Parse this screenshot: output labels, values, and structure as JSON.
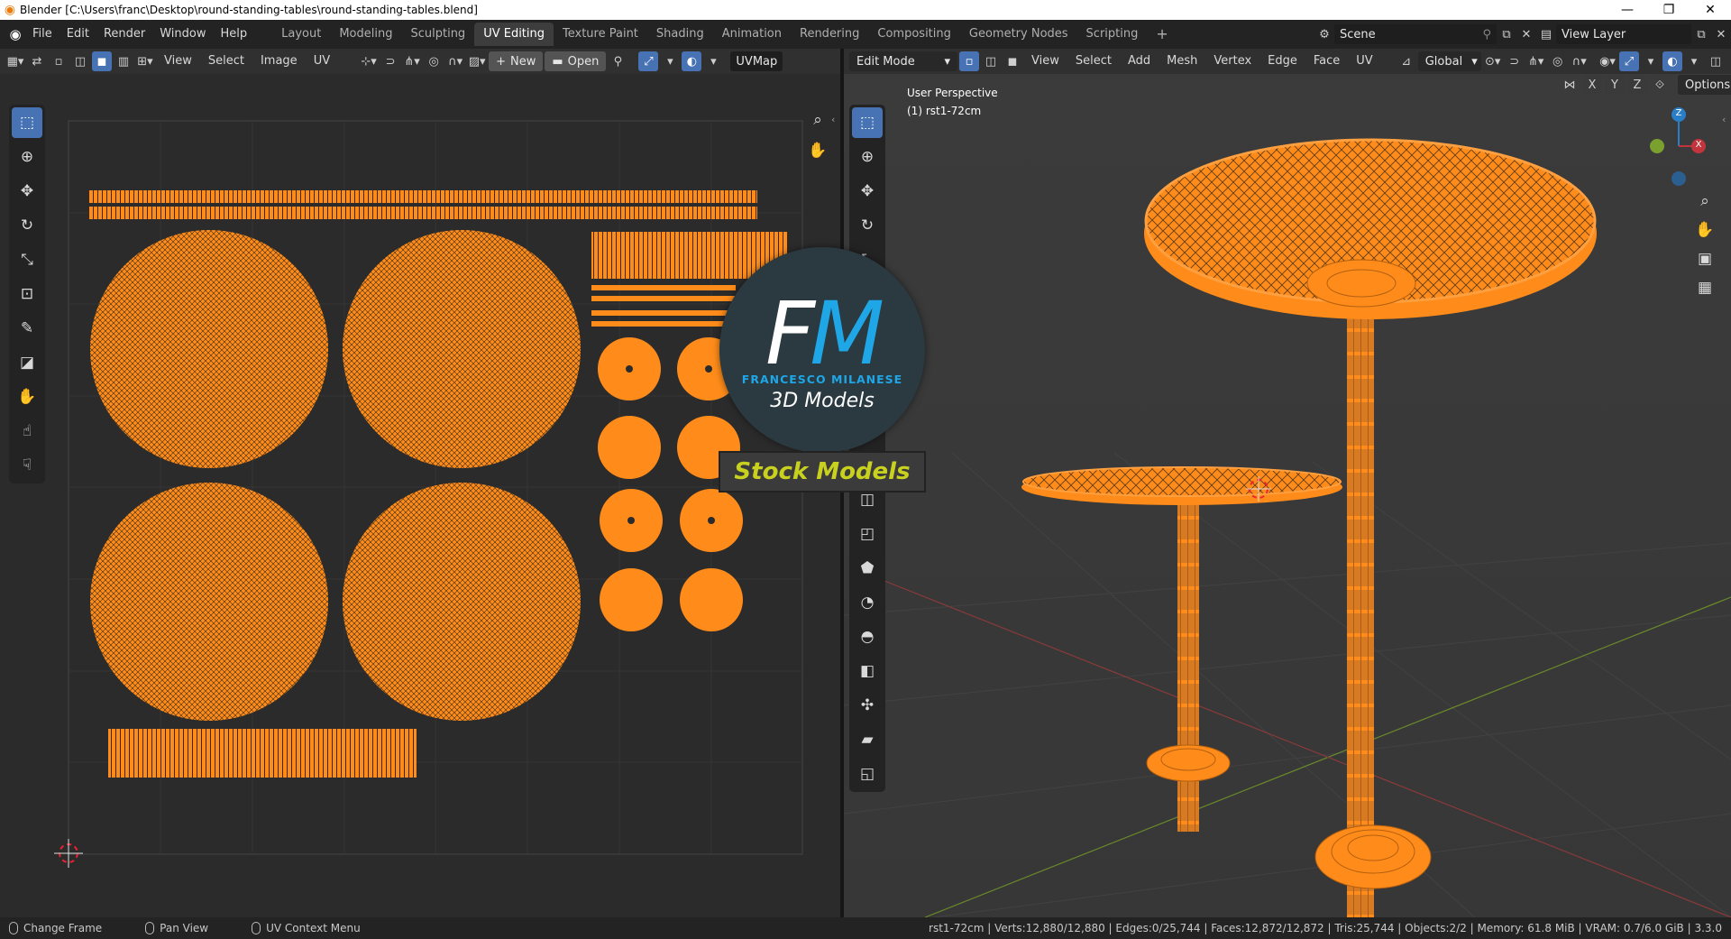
{
  "window": {
    "title": "Blender [C:\\Users\\franc\\Desktop\\round-standing-tables\\round-standing-tables.blend]",
    "minimize": "—",
    "maximize": "❐",
    "close": "✕"
  },
  "menu": {
    "file": "File",
    "edit": "Edit",
    "render": "Render",
    "window": "Window",
    "help": "Help"
  },
  "workspaces": [
    "Layout",
    "Modeling",
    "Sculpting",
    "UV Editing",
    "Texture Paint",
    "Shading",
    "Animation",
    "Rendering",
    "Compositing",
    "Geometry Nodes",
    "Scripting"
  ],
  "active_workspace": "UV Editing",
  "add_workspace": "+",
  "scene": {
    "label": "Scene"
  },
  "view_layer": {
    "label": "View Layer"
  },
  "uv_editor": {
    "menus": {
      "view": "View",
      "select": "Select",
      "image": "Image",
      "uv": "UV"
    },
    "new_button": "New",
    "open_button": "Open",
    "uvmap_label": "UVMap"
  },
  "viewport": {
    "mode": "Edit Mode",
    "menus": {
      "view": "View",
      "select": "Select",
      "add": "Add",
      "mesh": "Mesh",
      "vertex": "Vertex",
      "edge": "Edge",
      "face": "Face",
      "uv": "UV"
    },
    "transform_orientation": "Global",
    "axis_x": "X",
    "axis_y": "Y",
    "axis_z": "Z",
    "options": "Options",
    "overlay_line1": "User Perspective",
    "overlay_line2": "(1) rst1-72cm",
    "gizmo_z": "Z",
    "gizmo_x": "X"
  },
  "watermark": {
    "f": "F",
    "m": "M",
    "name": "FRANCESCO MILANESE",
    "subtitle": "3D Models",
    "banner": "Stock Models"
  },
  "status": {
    "left_action": "Change Frame",
    "middle_action": "Pan View",
    "right_action": "UV Context Menu",
    "stats": "rst1-72cm | Verts:12,880/12,880 | Edges:0/25,744 | Faces:12,872/12,872 | Tris:25,744 | Objects:2/2 | Memory: 61.8 MiB | VRAM: 0.7/6.0 GiB | 3.3.0"
  },
  "colors": {
    "accent": "#4772b3",
    "mesh": "#ff8c1a",
    "logo_blue": "#1ea6e6",
    "banner_text": "#c8d21e"
  }
}
